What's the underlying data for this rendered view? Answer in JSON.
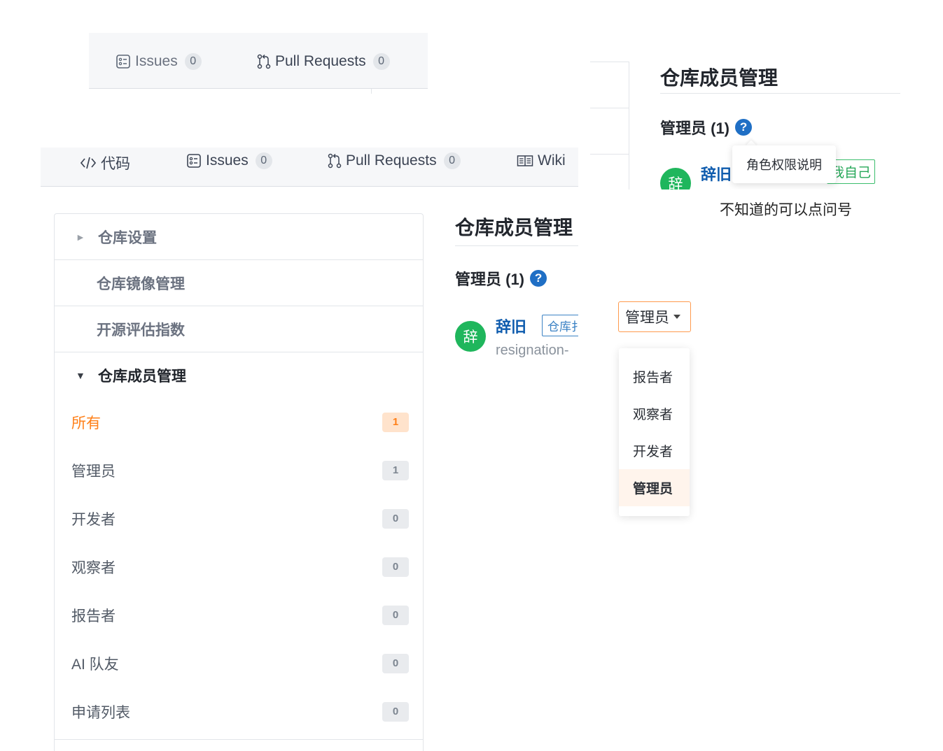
{
  "tabbar_top": {
    "issues": {
      "label": "Issues",
      "count": "0"
    },
    "pull_requests": {
      "label": "Pull Requests",
      "count": "0"
    }
  },
  "tabbar_main": {
    "code": {
      "label": "代码"
    },
    "issues": {
      "label": "Issues",
      "count": "0"
    },
    "pull_requests": {
      "label": "Pull Requests",
      "count": "0"
    },
    "wiki": {
      "label": "Wiki"
    }
  },
  "sidebar": {
    "repo_settings": "仓库设置",
    "mirror_management": "仓库镜像管理",
    "open_source_index": "开源评估指数",
    "member_management": "仓库成员管理",
    "members": [
      {
        "label": "所有",
        "count": "1",
        "active": true
      },
      {
        "label": "管理员",
        "count": "1"
      },
      {
        "label": "开发者",
        "count": "0"
      },
      {
        "label": "观察者",
        "count": "0"
      },
      {
        "label": "报告者",
        "count": "0"
      },
      {
        "label": "AI 队友",
        "count": "0"
      },
      {
        "label": "申请列表",
        "count": "0"
      }
    ]
  },
  "main": {
    "title": "仓库成员管理",
    "section": "管理员 (1)",
    "help_icon": "?",
    "member": {
      "avatar": "辞",
      "name": "辞旧",
      "role_tag": "仓库扌",
      "login": "resignation-"
    }
  },
  "popup": {
    "title": "仓库成员管理",
    "section": "管理员 (1)",
    "help_icon": "?",
    "tooltip": "角色权限说明",
    "avatar": "辞",
    "name": "辞旧",
    "self_tag": "我自己",
    "note": "不知道的可以点问号"
  },
  "role_select": {
    "value": "管理员",
    "options": [
      {
        "label": "报告者"
      },
      {
        "label": "观察者"
      },
      {
        "label": "开发者"
      },
      {
        "label": "管理员",
        "selected": true
      }
    ]
  },
  "colors": {
    "accent": "#ff7f17",
    "link": "#0f5cae",
    "avatar": "#1fb65c",
    "help": "#1f6fc5"
  },
  "icons": [
    "issues-icon",
    "pull-request-icon",
    "code-icon",
    "wiki-icon",
    "caret-right-icon",
    "caret-down-icon",
    "help-icon",
    "chevron-down-icon"
  ]
}
